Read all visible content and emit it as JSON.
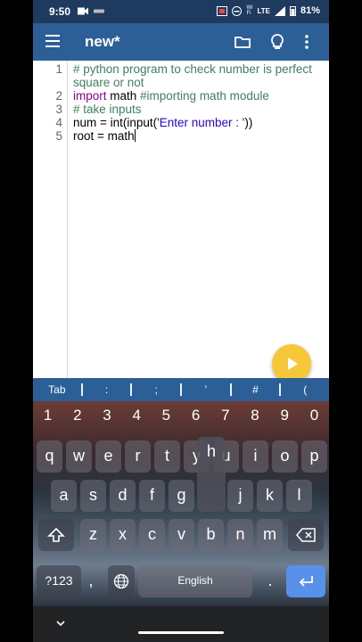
{
  "status": {
    "time": "9:50",
    "battery": "81%",
    "net_label": "LTE"
  },
  "appbar": {
    "title": "new*"
  },
  "editor": {
    "lines": [
      {
        "num": "1",
        "text_a": "# python program to check number is perfect",
        "text_b": "square or not"
      },
      {
        "num": "2",
        "kw": "import",
        "rest": " math ",
        "comment": "#importing math module"
      },
      {
        "num": "3",
        "comment": "# take inputs"
      },
      {
        "num": "4",
        "pre": "num = int(input(",
        "str": "'Enter number : '",
        "post": "))"
      },
      {
        "num": "5",
        "text": "root = math"
      }
    ]
  },
  "symbols": [
    "Tab",
    ":",
    ";",
    "'",
    "#",
    "("
  ],
  "keyboard": {
    "numbers": [
      "1",
      "2",
      "3",
      "4",
      "5",
      "6",
      "7",
      "8",
      "9",
      "0"
    ],
    "row1": [
      "q",
      "w",
      "e",
      "r",
      "t",
      "y",
      "u",
      "i",
      "o",
      "p"
    ],
    "popup_key": "h",
    "row2": [
      "a",
      "s",
      "d",
      "f",
      "g",
      "h",
      "j",
      "k",
      "l"
    ],
    "row3": [
      "z",
      "x",
      "c",
      "v",
      "b",
      "n",
      "m"
    ],
    "sym_key": "?123",
    "comma": ",",
    "space_label": "English",
    "period": "."
  },
  "colors": {
    "appbar": "#2d5f97",
    "status": "#1f3a5f",
    "fab": "#f6c739",
    "enter": "#5890ea"
  }
}
